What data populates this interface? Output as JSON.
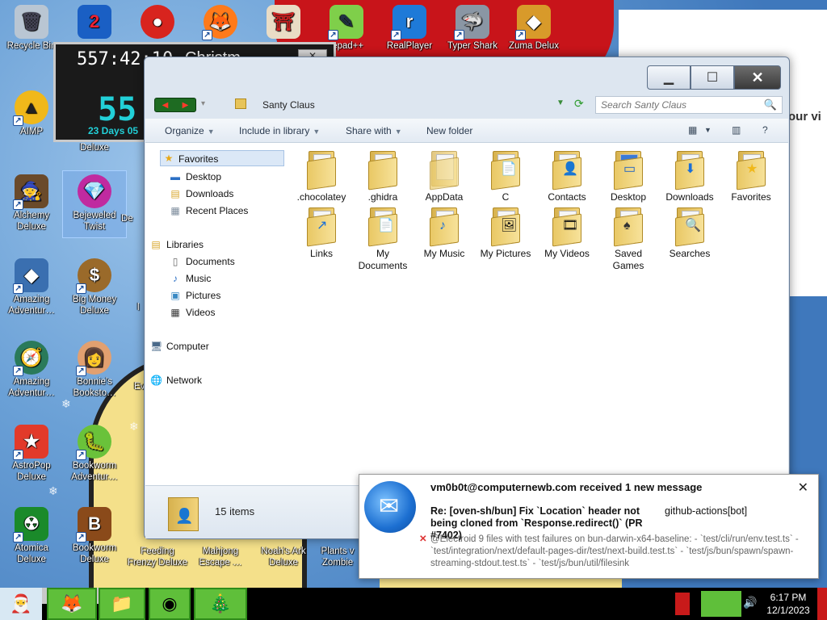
{
  "desktop": {
    "icons": [
      {
        "name": "recycle-bin",
        "label": "Recycle Bin",
        "glyph": "🗑"
      },
      {
        "name": "app-2",
        "label": "",
        "glyph": "2"
      },
      {
        "name": "app-red",
        "label": "",
        "glyph": "●"
      },
      {
        "name": "firefox",
        "label": "",
        "glyph": "🦊"
      },
      {
        "name": "app-gate",
        "label": "",
        "glyph": "⛩"
      },
      {
        "name": "notepadpp",
        "label": "tepad++",
        "glyph": "✎"
      },
      {
        "name": "realplayer",
        "label": "RealPlayer",
        "glyph": "r"
      },
      {
        "name": "typer-shark",
        "label": "Typer Shark",
        "glyph": "🦈"
      },
      {
        "name": "zuma-deluxe",
        "label": "Zuma Delux",
        "glyph": "◆"
      },
      {
        "name": "aimp",
        "label": "AIMP",
        "glyph": "▲"
      },
      {
        "name": "deluxe",
        "label": "Deluxe",
        "glyph": ""
      },
      {
        "name": "alchemy-deluxe",
        "label": "Alchemy Deluxe",
        "glyph": "🧙"
      },
      {
        "name": "bejeweled-twist",
        "label": "Bejeweled Twist",
        "glyph": "💎"
      },
      {
        "name": "amazing-adventures-1",
        "label": "Amazing Adventur…",
        "glyph": "◆"
      },
      {
        "name": "big-money-deluxe",
        "label": "Big Money Deluxe",
        "glyph": "$"
      },
      {
        "name": "amazing-adventures-2",
        "label": "Amazing Adventur…",
        "glyph": "🧭"
      },
      {
        "name": "bonnies-bookstore",
        "label": "Bonnie's Booksto…",
        "glyph": "👩"
      },
      {
        "name": "astropop-deluxe",
        "label": "AstroPop Deluxe",
        "glyph": "★"
      },
      {
        "name": "bookworm-adventures",
        "label": "Bookworm Adventur…",
        "glyph": "🐛"
      },
      {
        "name": "atomica-deluxe",
        "label": "Atomica Deluxe",
        "glyph": "☢"
      },
      {
        "name": "bookworm-deluxe",
        "label": "Bookworm Deluxe",
        "glyph": "B"
      },
      {
        "name": "feeding-frenzy-deluxe",
        "label": "Feeding Frenzy Deluxe",
        "glyph": ""
      },
      {
        "name": "mahjong-escape",
        "label": "Mahjong Escape …",
        "glyph": ""
      },
      {
        "name": "noahs-ark-deluxe",
        "label": "Noah's Ark Deluxe",
        "glyph": ""
      },
      {
        "name": "plants-vs-zombies",
        "label": "Plants v Zombie",
        "glyph": ""
      }
    ],
    "partial_labels": [
      "De",
      "l",
      "F",
      "Ev",
      "F F"
    ],
    "bg_window_text": "our vi"
  },
  "countdown": {
    "timer": "557:42:10",
    "label": "Christm",
    "big": "55",
    "days": "23 Days 05"
  },
  "explorer": {
    "address": "Santy Claus",
    "search_placeholder": "Search Santy Claus",
    "toolbar": {
      "organize": "Organize",
      "include": "Include in library",
      "share": "Share with",
      "new_folder": "New folder",
      "help": "?"
    },
    "nav": {
      "favorites": "Favorites",
      "fav_items": [
        "Desktop",
        "Downloads",
        "Recent Places"
      ],
      "libraries": "Libraries",
      "lib_items": [
        "Documents",
        "Music",
        "Pictures",
        "Videos"
      ],
      "computer": "Computer",
      "network": "Network"
    },
    "folders": [
      {
        "label": ".chocolatey",
        "badge": ""
      },
      {
        "label": ".ghidra",
        "badge": ""
      },
      {
        "label": "AppData",
        "badge": ""
      },
      {
        "label": "C",
        "badge": "📄"
      },
      {
        "label": "Contacts",
        "badge": "👤"
      },
      {
        "label": "Desktop",
        "badge": "▭"
      },
      {
        "label": "Downloads",
        "badge": "⬇"
      },
      {
        "label": "Favorites",
        "badge": "★"
      },
      {
        "label": "Links",
        "badge": "↗"
      },
      {
        "label": "My Documents",
        "badge": "📄"
      },
      {
        "label": "My Music",
        "badge": "♪"
      },
      {
        "label": "My Pictures",
        "badge": "🖼"
      },
      {
        "label": "My Videos",
        "badge": "🎞"
      },
      {
        "label": "Saved Games",
        "badge": "♠"
      },
      {
        "label": "Searches",
        "badge": "🔍"
      }
    ],
    "status": "15 items"
  },
  "notification": {
    "title": "vm0b0t@computernewb.com received 1 new message",
    "subject": "Re: [oven-sh/bun] Fix `Location` header not being cloned from `Response.redirect()` (PR #7402)",
    "sender": "github-actions[bot]",
    "body": "@Electroid 9 files with test failures on bun-darwin-x64-baseline: - `test/cli/run/env.test.ts` - `test/integration/next/default-pages-dir/test/next-build.test.ts` - `test/js/bun/spawn/spawn-streaming-stdout.test.ts` - `test/js/bun/util/filesink"
  },
  "taskbar": {
    "time": "6:17 PM",
    "date": "12/1/2023"
  },
  "colors": {
    "accent_green": "#5fbf3a",
    "tray_red": "#c81a1a",
    "countdown_cyan": "#22d0d8"
  }
}
